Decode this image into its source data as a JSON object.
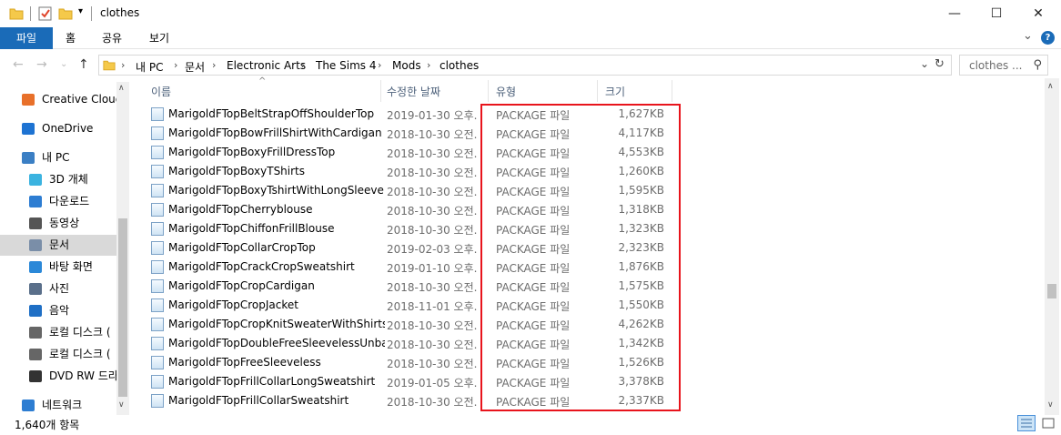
{
  "window": {
    "title": "clothes",
    "minimize": "—",
    "maximize": "☐",
    "close": "✕"
  },
  "ribbon": {
    "tabs": [
      "파일",
      "홈",
      "공유",
      "보기"
    ],
    "collapse_icon": "⌄",
    "help_icon": "?"
  },
  "address": {
    "back": "←",
    "forward": "→",
    "recent": "⌄",
    "up": "↑",
    "breadcrumbs": [
      "내 PC",
      "문서",
      "Electronic Arts",
      "The Sims 4",
      "Mods",
      "clothes"
    ],
    "dropdown_icon": "⌄",
    "refresh_icon": "↻",
    "search_placeholder": "clothes ...",
    "search_icon": "⚲"
  },
  "sidebar": {
    "items": [
      {
        "label": "Creative Cloud",
        "icon": "creative-cloud-icon",
        "color": "#e8702a"
      },
      {
        "label": "OneDrive",
        "icon": "onedrive-icon",
        "color": "#1e73d2"
      },
      {
        "label": "내 PC",
        "icon": "pc-icon",
        "color": "#3b7fc4"
      },
      {
        "label": "3D 개체",
        "icon": "3d-objects-icon",
        "color": "#3bb3e0"
      },
      {
        "label": "다운로드",
        "icon": "download-icon",
        "color": "#2d7dd2"
      },
      {
        "label": "동영상",
        "icon": "video-icon",
        "color": "#555555"
      },
      {
        "label": "문서",
        "icon": "documents-icon",
        "color": "#7a8ea8"
      },
      {
        "label": "바탕 화면",
        "icon": "desktop-icon",
        "color": "#2b88d8"
      },
      {
        "label": "사진",
        "icon": "pictures-icon",
        "color": "#5a6f8a"
      },
      {
        "label": "음악",
        "icon": "music-icon",
        "color": "#1f6fc5"
      },
      {
        "label": "로컬 디스크 (",
        "icon": "local-disk-icon",
        "color": "#666666"
      },
      {
        "label": "로컬 디스크 (",
        "icon": "local-disk-icon",
        "color": "#666666"
      },
      {
        "label": "DVD RW 드라",
        "icon": "dvd-drive-icon",
        "color": "#333333"
      },
      {
        "label": "네트워크",
        "icon": "network-icon",
        "color": "#2d7dd2"
      }
    ],
    "selected_index": 6
  },
  "columns": {
    "name": "이름",
    "date": "수정한 날짜",
    "type": "유형",
    "size": "크기"
  },
  "files": [
    {
      "name": "MarigoldFTopBeltStrapOffShoulderTop",
      "date": "2019-01-30 오후...",
      "type": "PACKAGE 파일",
      "size": "1,627KB"
    },
    {
      "name": "MarigoldFTopBowFrillShirtWithCardigan",
      "date": "2018-10-30 오전...",
      "type": "PACKAGE 파일",
      "size": "4,117KB"
    },
    {
      "name": "MarigoldFTopBoxyFrillDressTop",
      "date": "2018-10-30 오전...",
      "type": "PACKAGE 파일",
      "size": "4,553KB"
    },
    {
      "name": "MarigoldFTopBoxyTShirts",
      "date": "2018-10-30 오전...",
      "type": "PACKAGE 파일",
      "size": "1,260KB"
    },
    {
      "name": "MarigoldFTopBoxyTshirtWithLongSleeve",
      "date": "2018-10-30 오전...",
      "type": "PACKAGE 파일",
      "size": "1,595KB"
    },
    {
      "name": "MarigoldFTopCherryblouse",
      "date": "2018-10-30 오전...",
      "type": "PACKAGE 파일",
      "size": "1,318KB"
    },
    {
      "name": "MarigoldFTopChiffonFrillBlouse",
      "date": "2018-10-30 오전...",
      "type": "PACKAGE 파일",
      "size": "1,323KB"
    },
    {
      "name": "MarigoldFTopCollarCropTop",
      "date": "2019-02-03 오후...",
      "type": "PACKAGE 파일",
      "size": "2,323KB"
    },
    {
      "name": "MarigoldFTopCrackCropSweatshirt",
      "date": "2019-01-10 오후...",
      "type": "PACKAGE 파일",
      "size": "1,876KB"
    },
    {
      "name": "MarigoldFTopCropCardigan",
      "date": "2018-10-30 오전...",
      "type": "PACKAGE 파일",
      "size": "1,575KB"
    },
    {
      "name": "MarigoldFTopCropJacket",
      "date": "2018-11-01 오후...",
      "type": "PACKAGE 파일",
      "size": "1,550KB"
    },
    {
      "name": "MarigoldFTopCropKnitSweaterWithShirts",
      "date": "2018-10-30 오전...",
      "type": "PACKAGE 파일",
      "size": "4,262KB"
    },
    {
      "name": "MarigoldFTopDoubleFreeSleevelessUnba...",
      "date": "2018-10-30 오전...",
      "type": "PACKAGE 파일",
      "size": "1,342KB"
    },
    {
      "name": "MarigoldFTopFreeSleeveless",
      "date": "2018-10-30 오전...",
      "type": "PACKAGE 파일",
      "size": "1,526KB"
    },
    {
      "name": "MarigoldFTopFrillCollarLongSweatshirt",
      "date": "2019-01-05 오후...",
      "type": "PACKAGE 파일",
      "size": "3,378KB"
    },
    {
      "name": "MarigoldFTopFrillCollarSweatshirt",
      "date": "2018-10-30 오전...",
      "type": "PACKAGE 파일",
      "size": "2,337KB"
    }
  ],
  "status": {
    "item_count": "1,640개 항목"
  },
  "colors": {
    "accent": "#1a6bb8",
    "highlight_border": "#e8141c",
    "selected_bg": "#d9d9d9"
  }
}
